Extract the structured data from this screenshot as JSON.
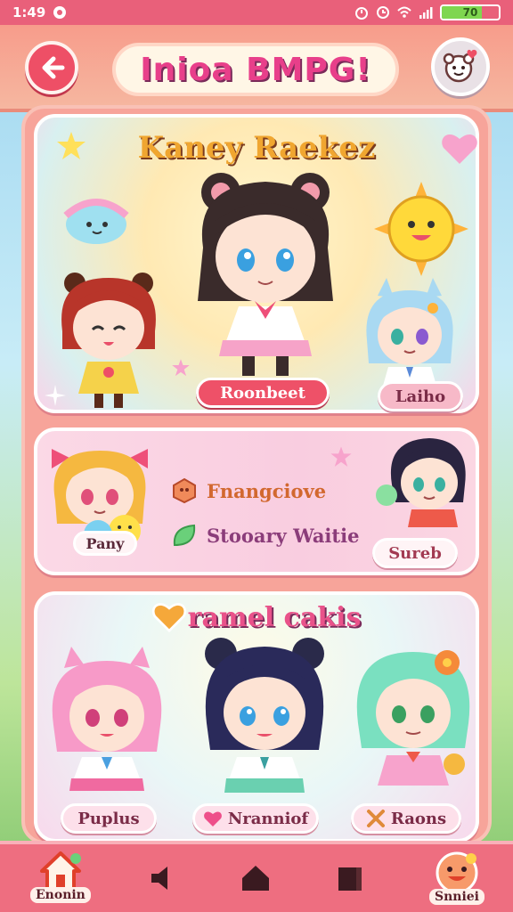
{
  "status_bar": {
    "time": "1:49",
    "battery_text": "70",
    "battery_level": 0.7
  },
  "header": {
    "title": "Inioa BMPG!",
    "back_icon": "back-arrow-icon",
    "profile_icon": "profile-face-icon"
  },
  "card_1": {
    "title": "Kaney Raekez",
    "tags": [
      "Roonbeet",
      "Laiho"
    ]
  },
  "card_2": {
    "character_label": "Pany",
    "features": [
      "Fnangciove",
      "Stooary Waitie"
    ],
    "button_label": "Sureb"
  },
  "card_3": {
    "title": "ramel cakis",
    "tags": [
      "Puplus",
      "Nranniof",
      "Raons"
    ]
  },
  "bottom_nav": {
    "home_label": "Enonin",
    "smile_label": "Snniei"
  },
  "colors": {
    "accent": "#ee5168",
    "header_bg": "#f79c8b",
    "nav_bg": "#ee6e80"
  }
}
